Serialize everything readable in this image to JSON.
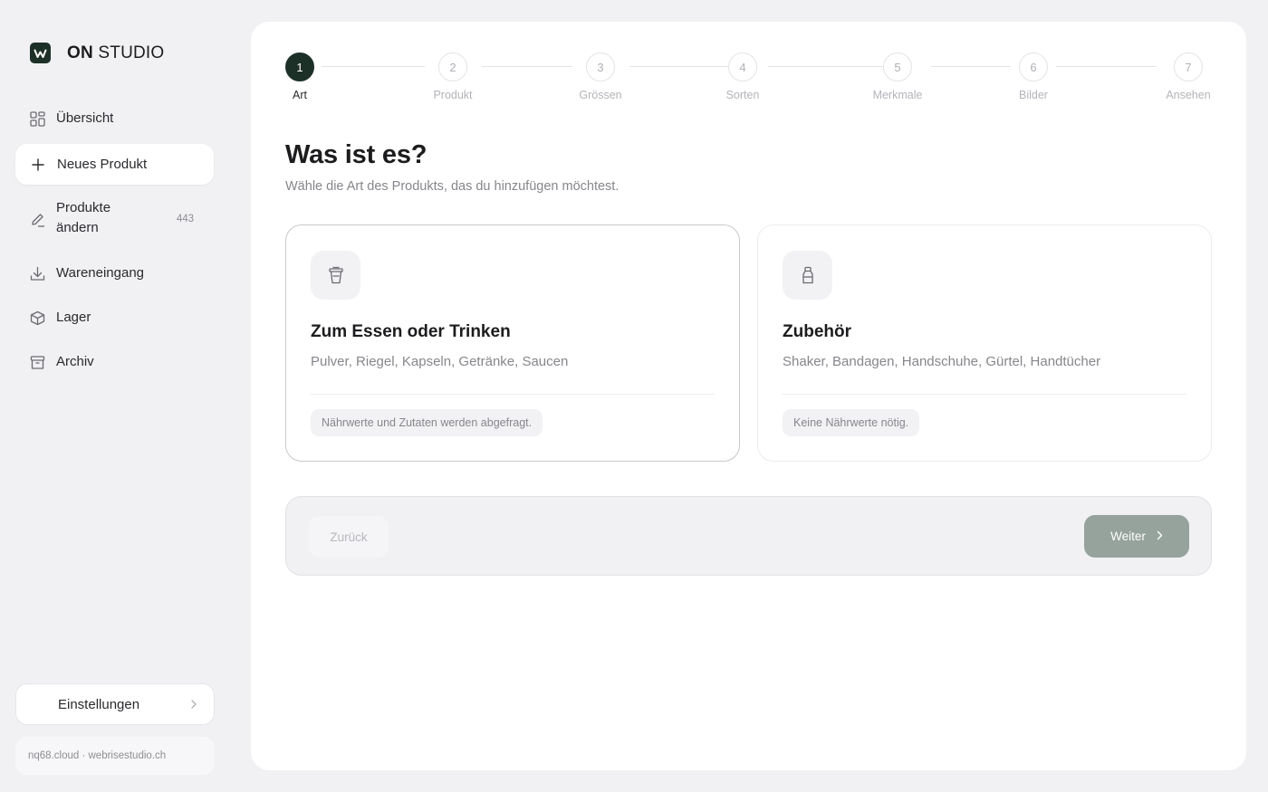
{
  "brand": {
    "name_bold": "ON",
    "name_light": "STUDIO"
  },
  "nav": {
    "items": [
      {
        "label": "Übersicht",
        "icon": "grid-icon"
      },
      {
        "label": "Neues Produkt",
        "icon": "plus-icon",
        "active": true
      },
      {
        "label_line1": "Produkte",
        "label_line2": "ändern",
        "count": "443",
        "icon": "pencil-icon"
      },
      {
        "label": "Wareneingang",
        "icon": "download-icon"
      },
      {
        "label": "Lager",
        "icon": "box-icon"
      },
      {
        "label": "Archiv",
        "icon": "archive-icon"
      }
    ],
    "settings_label": "Einstellungen",
    "footer_text": "nq68.cloud · webrisestudio.ch"
  },
  "stepper": {
    "current": 1,
    "steps": [
      {
        "num": "1",
        "label": "Art"
      },
      {
        "num": "2",
        "label": "Produkt"
      },
      {
        "num": "3",
        "label": "Grössen"
      },
      {
        "num": "4",
        "label": "Sorten"
      },
      {
        "num": "5",
        "label": "Merkmale"
      },
      {
        "num": "6",
        "label": "Bilder"
      },
      {
        "num": "7",
        "label": "Ansehen"
      }
    ]
  },
  "page": {
    "title": "Was ist es?",
    "subtitle": "Wähle die Art des Produkts, das du hinzufügen möchtest."
  },
  "options": [
    {
      "title": "Zum Essen oder Trinken",
      "description": "Pulver, Riegel, Kapseln, Getränke, Saucen",
      "note": "Nährwerte und Zutaten werden abgefragt.",
      "icon": "cup-icon",
      "selected": true
    },
    {
      "title": "Zubehör",
      "description": "Shaker, Bandagen, Handschuhe, Gürtel, Handtücher",
      "note": "Keine Nährwerte nötig.",
      "icon": "bottle-icon",
      "selected": false
    }
  ],
  "actions": {
    "back_label": "Zurück",
    "next_label": "Weiter"
  },
  "colors": {
    "accent": "#1d3028",
    "next_button": "#95a39c",
    "background": "#f1f1f4"
  }
}
